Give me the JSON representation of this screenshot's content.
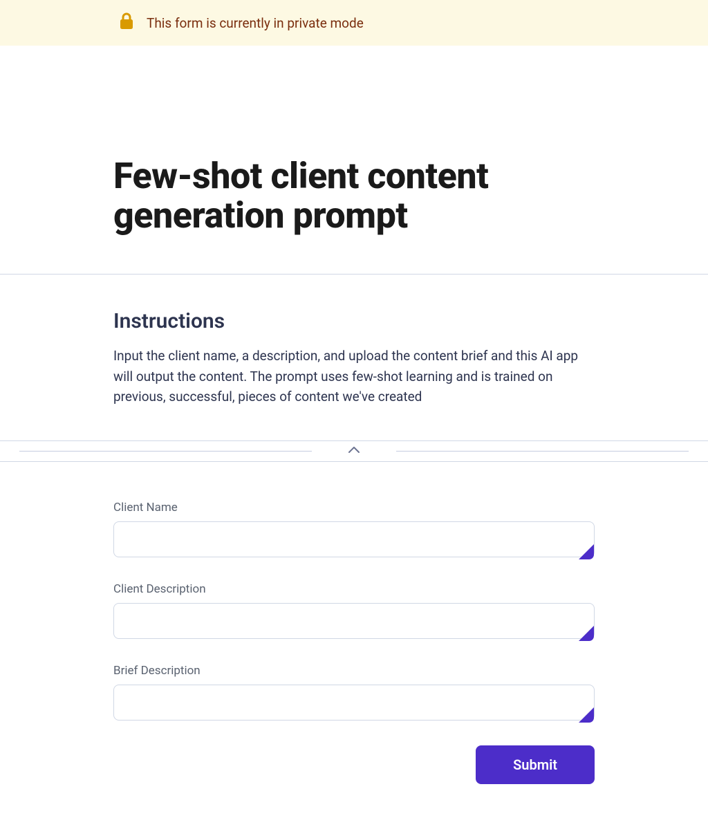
{
  "banner": {
    "text": "This form is currently in private mode"
  },
  "header": {
    "title": "Few-shot client content generation prompt"
  },
  "instructions": {
    "heading": "Instructions",
    "body": "Input the client name, a description, and upload the content brief and this AI app will output the content. The prompt uses few-shot learning and is trained on previous, successful, pieces of content we've created"
  },
  "form": {
    "fields": [
      {
        "label": "Client Name",
        "value": ""
      },
      {
        "label": "Client Description",
        "value": ""
      },
      {
        "label": "Brief Description",
        "value": ""
      }
    ],
    "submit_label": "Submit"
  },
  "colors": {
    "accent": "#4c2dc9",
    "banner_bg": "#fdf9e3",
    "banner_text": "#7a2e0e",
    "lock_icon": "#d99a00"
  }
}
